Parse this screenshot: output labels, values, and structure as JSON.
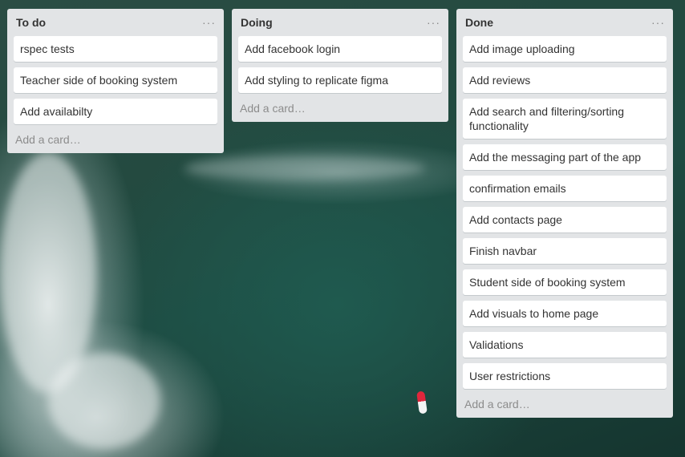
{
  "lists": [
    {
      "title": "To do",
      "menu": "···",
      "cards": [
        "rspec tests",
        "Teacher side of booking system",
        "Add availabilty"
      ],
      "add_card": "Add a card…"
    },
    {
      "title": "Doing",
      "menu": "···",
      "cards": [
        "Add facebook login",
        "Add styling to replicate figma"
      ],
      "add_card": "Add a card…"
    },
    {
      "title": "Done",
      "menu": "···",
      "cards": [
        "Add image uploading",
        "Add reviews",
        "Add search and filtering/sorting functionality",
        "Add the messaging part of the app",
        "confirmation emails",
        "Add contacts page",
        "Finish navbar",
        "Student side of booking system",
        "Add visuals to home page",
        "Validations",
        "User restrictions"
      ],
      "add_card": "Add a card…"
    }
  ]
}
